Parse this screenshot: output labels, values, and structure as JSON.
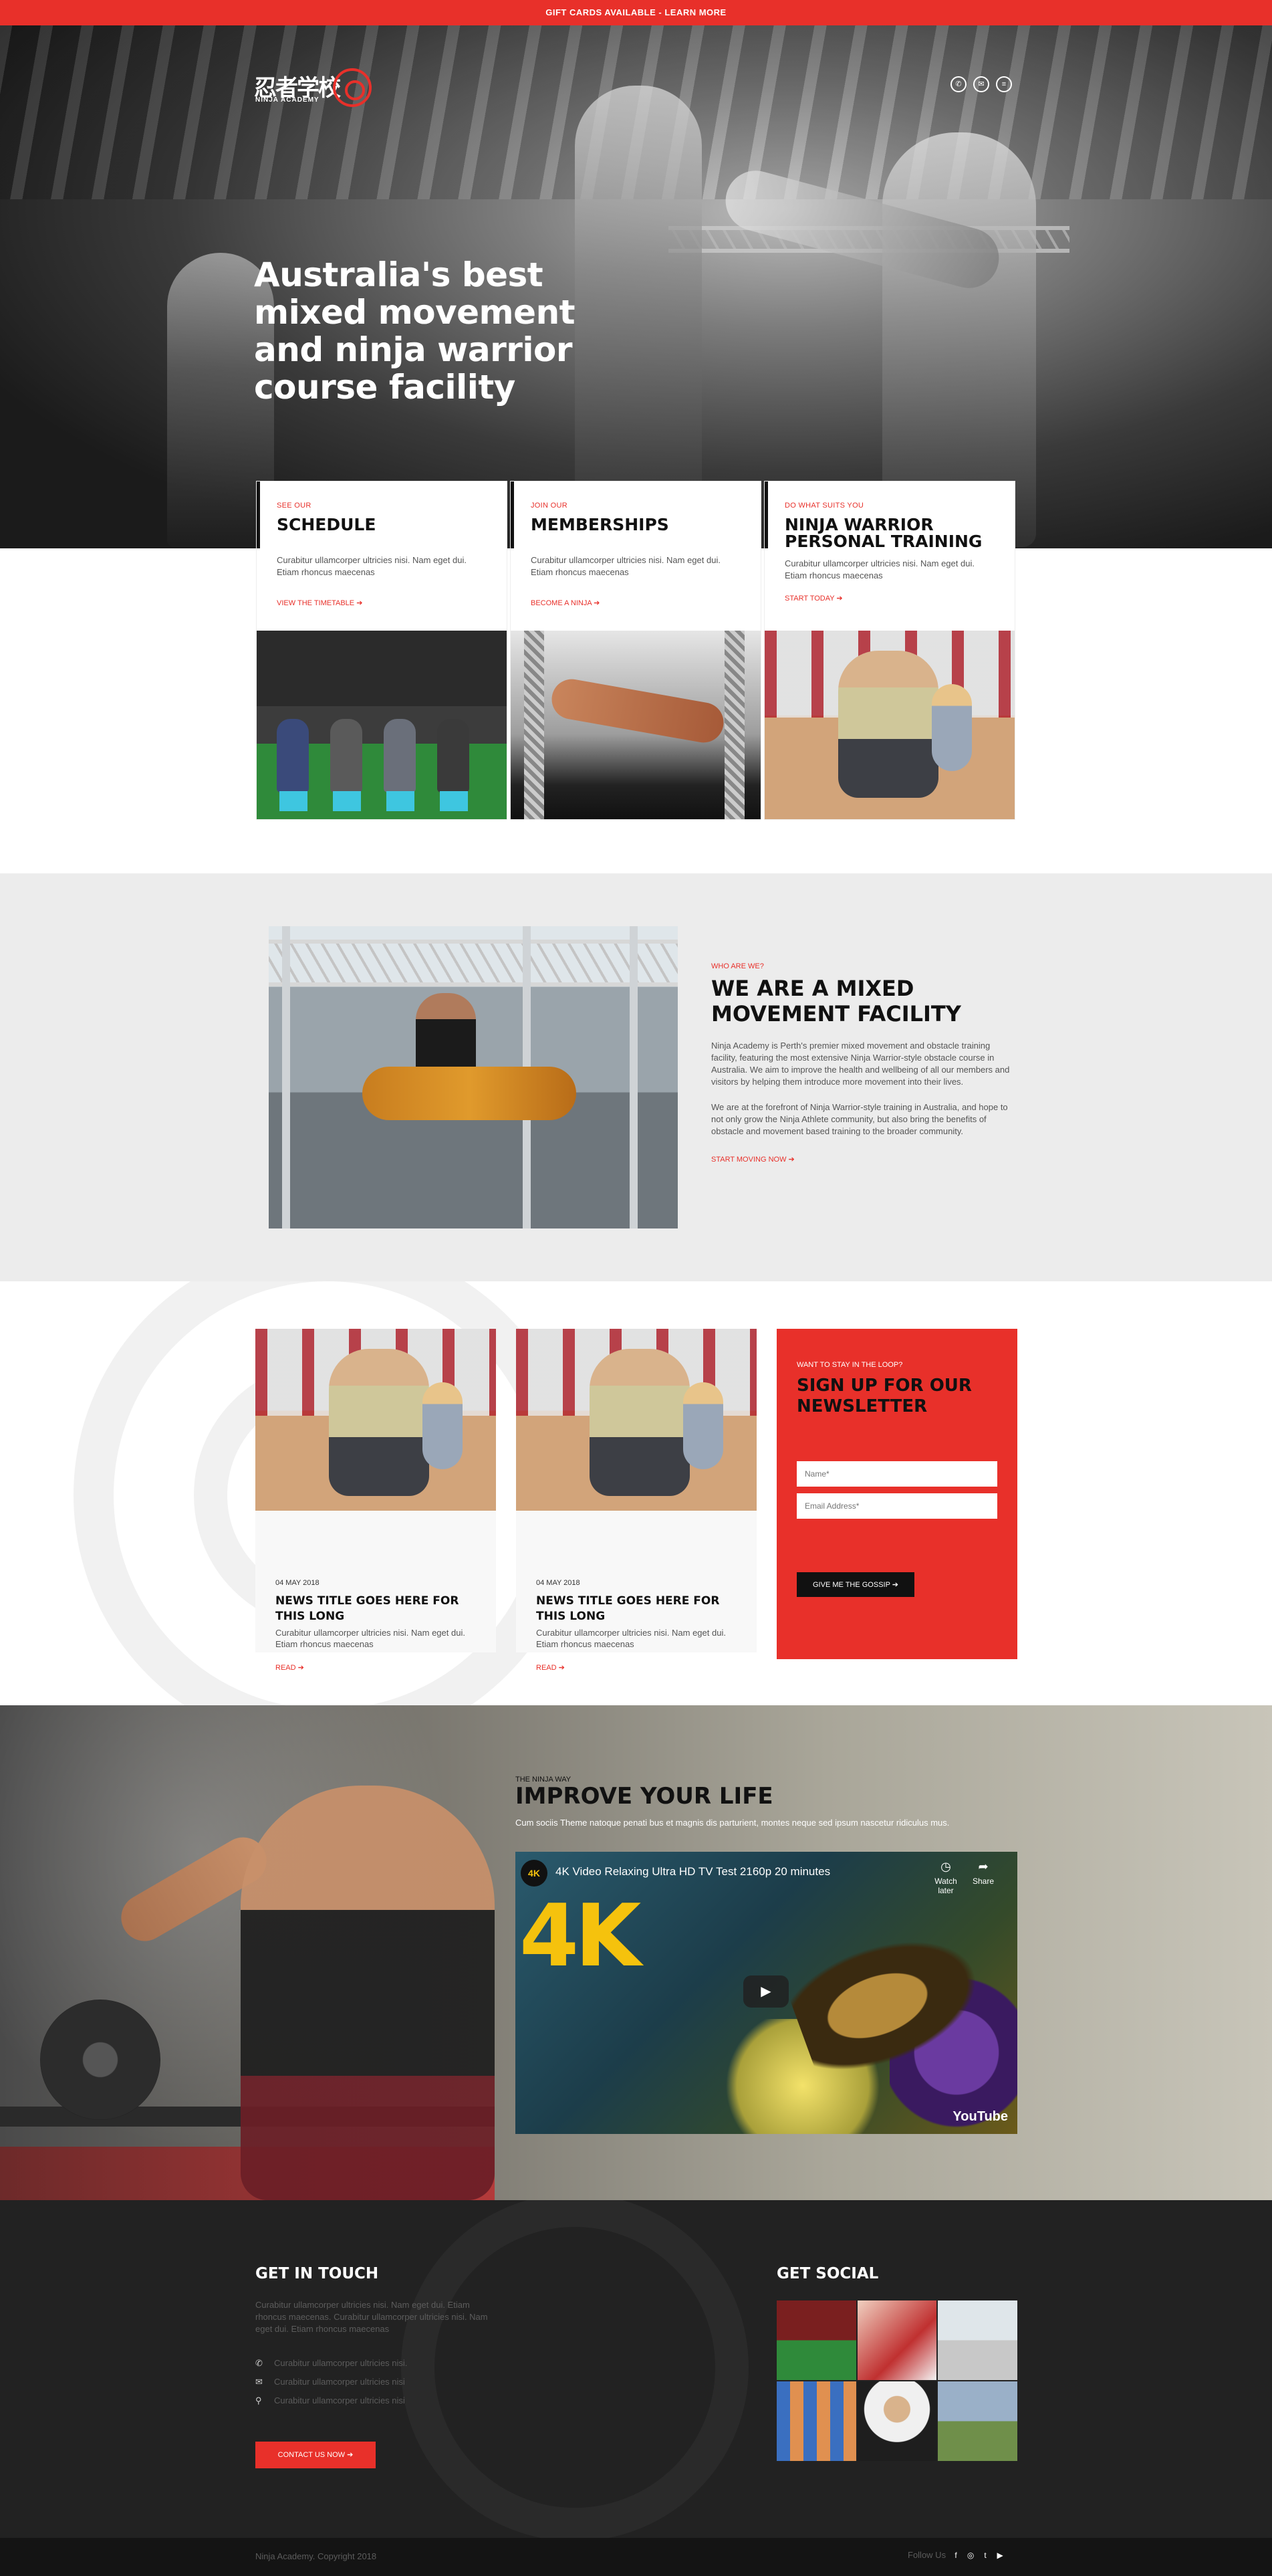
{
  "topbar": {
    "text": "GIFT CARDS AVAILABLE - LEARN MORE"
  },
  "logo": {
    "kanji": "忍者学校",
    "academy": "NINJA ACADEMY"
  },
  "hero": {
    "icons": [
      "phone-icon",
      "mail-icon",
      "menu-icon"
    ],
    "title": "Australia's best mixed movement and ninja warrior course facility"
  },
  "cards": [
    {
      "pre": "SEE OUR",
      "title": "SCHEDULE",
      "text": "Curabitur ullamcorper ultricies nisi. Nam eget dui. Etiam rhoncus maecenas",
      "link": "VIEW THE TIMETABLE ➔"
    },
    {
      "pre": "JOIN OUR",
      "title": "MEMBERSHIPS",
      "text": "Curabitur ullamcorper ultricies nisi. Nam eget dui. Etiam rhoncus maecenas",
      "link": "BECOME A NINJA ➔"
    },
    {
      "pre": "DO WHAT SUITS YOU",
      "title": "NINJA WARRIOR PERSONAL TRAINING",
      "text": "Curabitur ullamcorper ultricies nisi. Nam eget dui. Etiam rhoncus maecenas",
      "link": "START TODAY ➔"
    }
  ],
  "about": {
    "pre": "WHO ARE WE?",
    "title": "WE ARE A MIXED MOVEMENT FACILITY",
    "p1": "Ninja Academy is Perth's premier mixed movement and obstacle training facility, featuring the most extensive Ninja Warrior-style obstacle course in Australia. We aim to improve the health and wellbeing of all our members and visitors by helping them introduce more movement into their lives.",
    "p2": "We are at the forefront of Ninja Warrior-style training in Australia, and hope to not only grow the Ninja Athlete community, but also bring the benefits of obstacle and movement based training to the broader community.",
    "link": "START MOVING NOW ➔"
  },
  "news": [
    {
      "date": "04 MAY 2018",
      "title": "NEWS TITLE GOES HERE FOR THIS LONG",
      "text": "Curabitur ullamcorper ultricies nisi. Nam eget dui. Etiam rhoncus maecenas",
      "link": "READ ➔"
    },
    {
      "date": "04 MAY 2018",
      "title": "NEWS TITLE GOES HERE FOR THIS LONG",
      "text": "Curabitur ullamcorper ultricies nisi. Nam eget dui. Etiam rhoncus maecenas",
      "link": "READ ➔"
    }
  ],
  "newsletter": {
    "pre": "WANT TO STAY IN THE LOOP?",
    "title": "SIGN UP FOR OUR NEWSLETTER",
    "name_placeholder": "Name*",
    "email_placeholder": "Email Address*",
    "button": "GIVE ME THE GOSSIP ➔"
  },
  "ninja_way": {
    "pre": "THE NINJA WAY",
    "title": "IMPROVE YOUR LIFE",
    "desc": "Cum sociis Theme natoque penati bus et magnis dis parturient, montes neque sed ipsum nascetur ridiculus mus.",
    "video": {
      "badge": "4K",
      "title": "4K Video Relaxing Ultra HD TV Test 2160p 20 minutes",
      "big": "4K",
      "watch_later": "Watch later",
      "share": "Share",
      "play": "▶",
      "youtube": "YouTube"
    }
  },
  "footer": {
    "touch_title": "GET IN TOUCH",
    "intro": "Curabitur ullamcorper ultricies nisi. Nam eget dui. Etiam rhoncus maecenas. Curabitur ullamcorper ultricies nisi. Nam eget dui. Etiam rhoncus maecenas",
    "contacts": [
      {
        "icon": "phone-icon",
        "glyph": "✆",
        "text": "Curabitur ullamcorper ultricies nisi."
      },
      {
        "icon": "mail-icon",
        "glyph": "✉",
        "text": "Curabitur ullamcorper ultricies nisi"
      },
      {
        "icon": "location-icon",
        "glyph": "⚲",
        "text": "Curabitur ullamcorper ultricies nisi"
      }
    ],
    "cta": "CONTACT US NOW ➔",
    "social_title": "GET SOCIAL",
    "copyright": "Ninja Academy. Copyright 2018",
    "follow": "Follow Us",
    "social_icons": [
      "facebook-icon",
      "instagram-icon",
      "twitter-icon",
      "youtube-icon"
    ]
  },
  "colors": {
    "accent": "#e8302a",
    "dark": "#222222"
  }
}
